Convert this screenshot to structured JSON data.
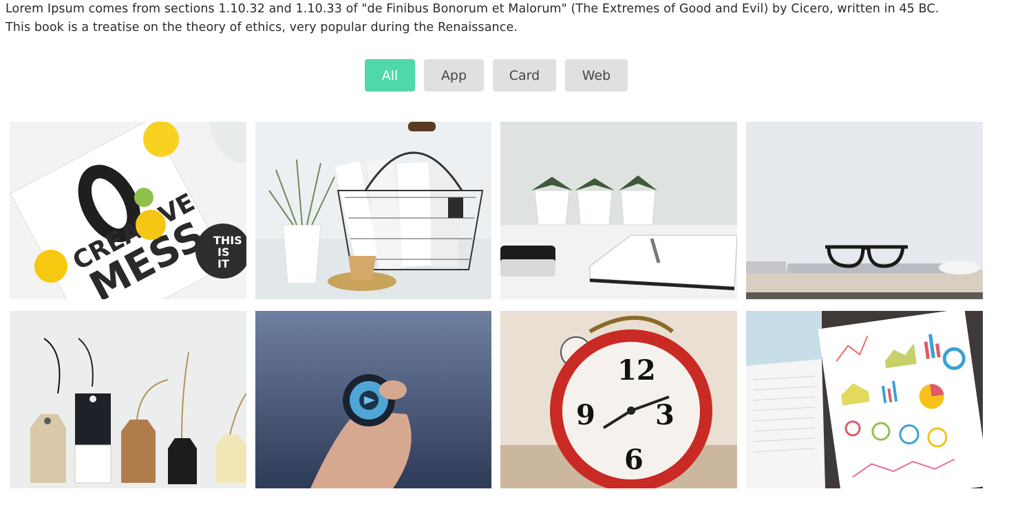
{
  "intro": {
    "line1": "Lorem Ipsum comes from sections 1.10.32 and 1.10.33 of \"de Finibus Bonorum et Malorum\" (The Extremes of Good and Evil) by Cicero, written in 45 BC.",
    "line2": "This book is a treatise on the theory of ethics, very popular during the Renaissance."
  },
  "filters": [
    {
      "label": "All",
      "active": true
    },
    {
      "label": "App",
      "active": false
    },
    {
      "label": "Card",
      "active": false
    },
    {
      "label": "Web",
      "active": false
    }
  ],
  "gallery": {
    "tile0": {
      "creative": "CREATIVE",
      "mess": "MESS",
      "badge1": "THIS",
      "badge2": "IS",
      "badge3": "IT"
    },
    "tile6": {
      "n12": "12",
      "n9": "9",
      "n3": "3",
      "n6": "6"
    },
    "colors": {
      "accent": "#4fd8a9",
      "button_bg": "#e0e0e0"
    }
  }
}
